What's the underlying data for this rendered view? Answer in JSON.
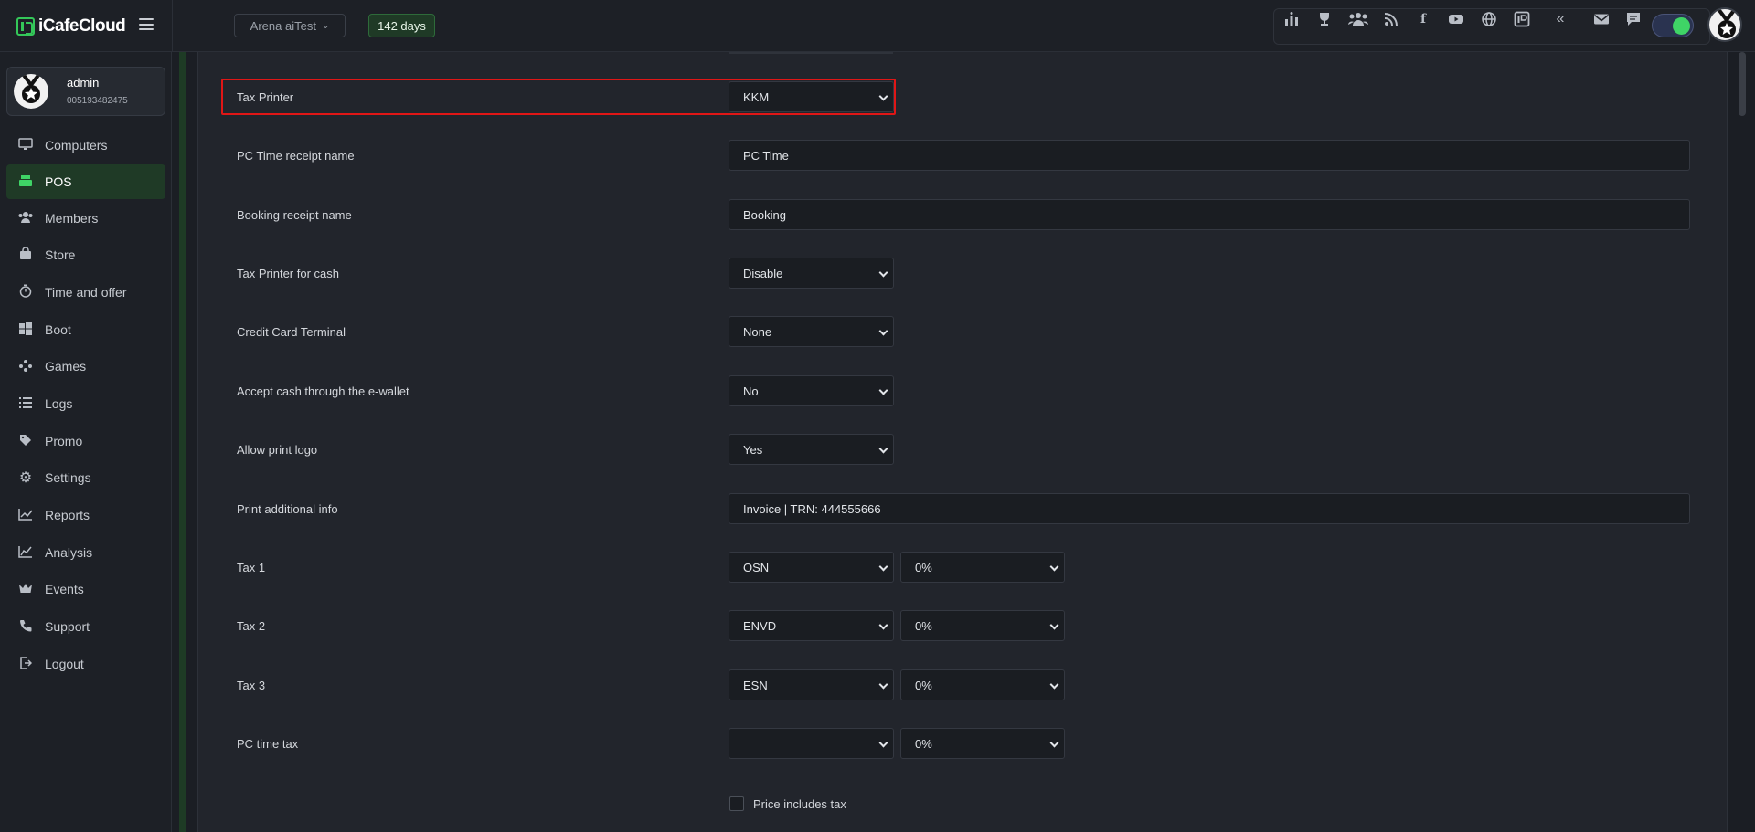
{
  "app": {
    "logo_text": "iCafeCloud",
    "accent_color": "#3fd466",
    "highlight_color": "#e01616"
  },
  "header": {
    "cafe_selector": "Arena aiTest",
    "license_days": "142 days",
    "tool_icons": [
      "leaderboard-icon",
      "trophy-icon",
      "users-group-icon",
      "rss-icon",
      "facebook-icon",
      "youtube-icon",
      "globe-icon",
      "icafe-icon",
      "double-chevron-left-icon",
      "mail-icon",
      "chat-icon"
    ],
    "theme_toggle": "on"
  },
  "sidebar": {
    "user": {
      "name": "admin",
      "id": "005193482475"
    },
    "items": [
      {
        "label": "Computers",
        "icon": "monitor-icon"
      },
      {
        "label": "POS",
        "icon": "cash-register-icon",
        "active": true
      },
      {
        "label": "Members",
        "icon": "members-icon"
      },
      {
        "label": "Store",
        "icon": "shopping-bag-icon"
      },
      {
        "label": "Time and offer",
        "icon": "stopwatch-icon"
      },
      {
        "label": "Boot",
        "icon": "windows-icon"
      },
      {
        "label": "Games",
        "icon": "gamepad-icon"
      },
      {
        "label": "Logs",
        "icon": "list-icon"
      },
      {
        "label": "Promo",
        "icon": "tag-icon"
      },
      {
        "label": "Settings",
        "icon": "gear-icon"
      },
      {
        "label": "Reports",
        "icon": "line-chart-icon"
      },
      {
        "label": "Analysis",
        "icon": "area-chart-icon"
      },
      {
        "label": "Events",
        "icon": "crown-icon"
      },
      {
        "label": "Support",
        "icon": "phone-icon"
      },
      {
        "label": "Logout",
        "icon": "logout-icon"
      }
    ]
  },
  "form": {
    "tax_printer": {
      "label": "Tax Printer",
      "value": "KKM"
    },
    "pc_time_receipt": {
      "label": "PC Time receipt name",
      "value": "PC Time"
    },
    "booking_receipt": {
      "label": "Booking receipt name",
      "value": "Booking"
    },
    "tax_printer_cash": {
      "label": "Tax Printer for cash",
      "value": "Disable"
    },
    "credit_card_terminal": {
      "label": "Credit Card Terminal",
      "value": "None"
    },
    "accept_cash_ewallet": {
      "label": "Accept cash through the e-wallet",
      "value": "No"
    },
    "allow_print_logo": {
      "label": "Allow print logo",
      "value": "Yes"
    },
    "print_additional_info": {
      "label": "Print additional info",
      "value": "Invoice | TRN: 444555666"
    },
    "tax1": {
      "label": "Tax 1",
      "type": "OSN",
      "rate": "0%"
    },
    "tax2": {
      "label": "Tax 2",
      "type": "ENVD",
      "rate": "0%"
    },
    "tax3": {
      "label": "Tax 3",
      "type": "ESN",
      "rate": "0%"
    },
    "pc_time_tax": {
      "label": "PC time tax",
      "type": "",
      "rate": "0%"
    },
    "price_includes_tax": {
      "label": "Price includes tax",
      "checked": false
    }
  }
}
